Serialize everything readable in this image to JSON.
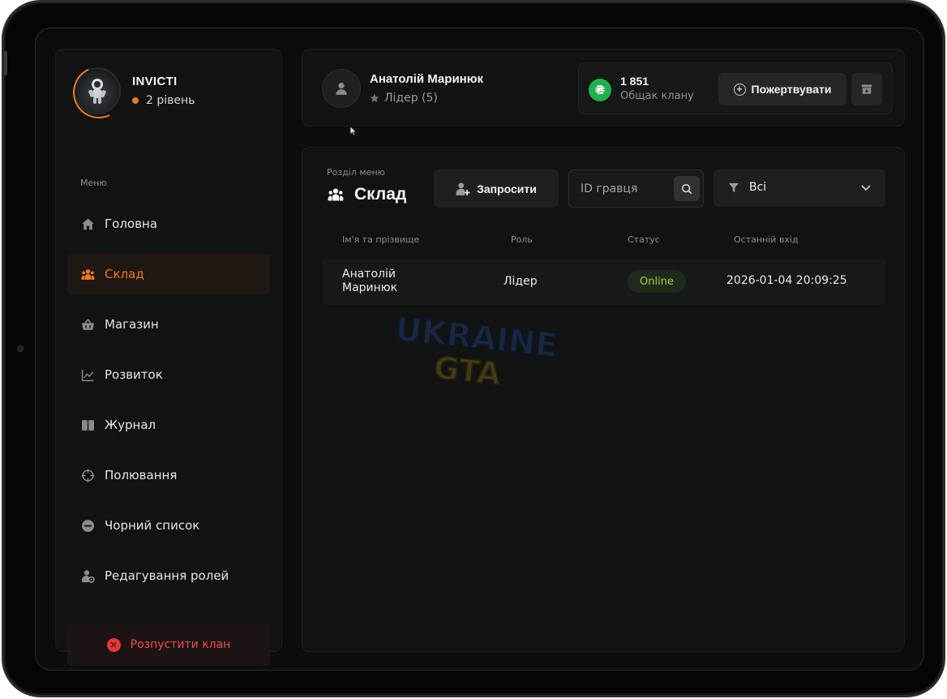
{
  "clan": {
    "name": "INVICTI",
    "level": "2 рівень"
  },
  "sidebar": {
    "caption": "Меню",
    "items": [
      {
        "label": "Головна",
        "icon": "home-icon"
      },
      {
        "label": "Склад",
        "icon": "people-icon",
        "active": true
      },
      {
        "label": "Магазин",
        "icon": "basket-icon"
      },
      {
        "label": "Розвиток",
        "icon": "chart-line-icon"
      },
      {
        "label": "Журнал",
        "icon": "book-icon"
      },
      {
        "label": "Полювання",
        "icon": "crosshair-icon"
      },
      {
        "label": "Чорний список",
        "icon": "block-icon"
      },
      {
        "label": "Редагування ролей",
        "icon": "user-gear-icon"
      }
    ],
    "disband_label": "Розпустити клан"
  },
  "user": {
    "name": "Анатолій Маринюк",
    "role": "Лідер (5)"
  },
  "treasury": {
    "currency_symbol": "₴",
    "amount": "1 851",
    "label": "Общак клану",
    "donate_label": "Пожертвувати"
  },
  "main": {
    "caption": "Розділ меню",
    "title": "Склад",
    "invite_label": "Запросити",
    "search_placeholder": "ID гравця",
    "filter_value": "Всі",
    "columns": {
      "name": "Ім'я та прізвище",
      "role": "Роль",
      "status": "Статус",
      "last_login": "Останній вхід"
    },
    "rows": [
      {
        "name": "Анатолій Маринюк",
        "role": "Лідер",
        "status": "Online",
        "last_login": "2026-01-04 20:09:25"
      }
    ]
  },
  "watermark": {
    "line1": "UKRAINE",
    "line2": "GTA"
  },
  "colors": {
    "accent": "#f07a1a",
    "online": "#9fd23e",
    "danger": "#f24a4a",
    "coin": "#1fb24a",
    "background": "#0b0c0c",
    "panel": "#111313"
  }
}
